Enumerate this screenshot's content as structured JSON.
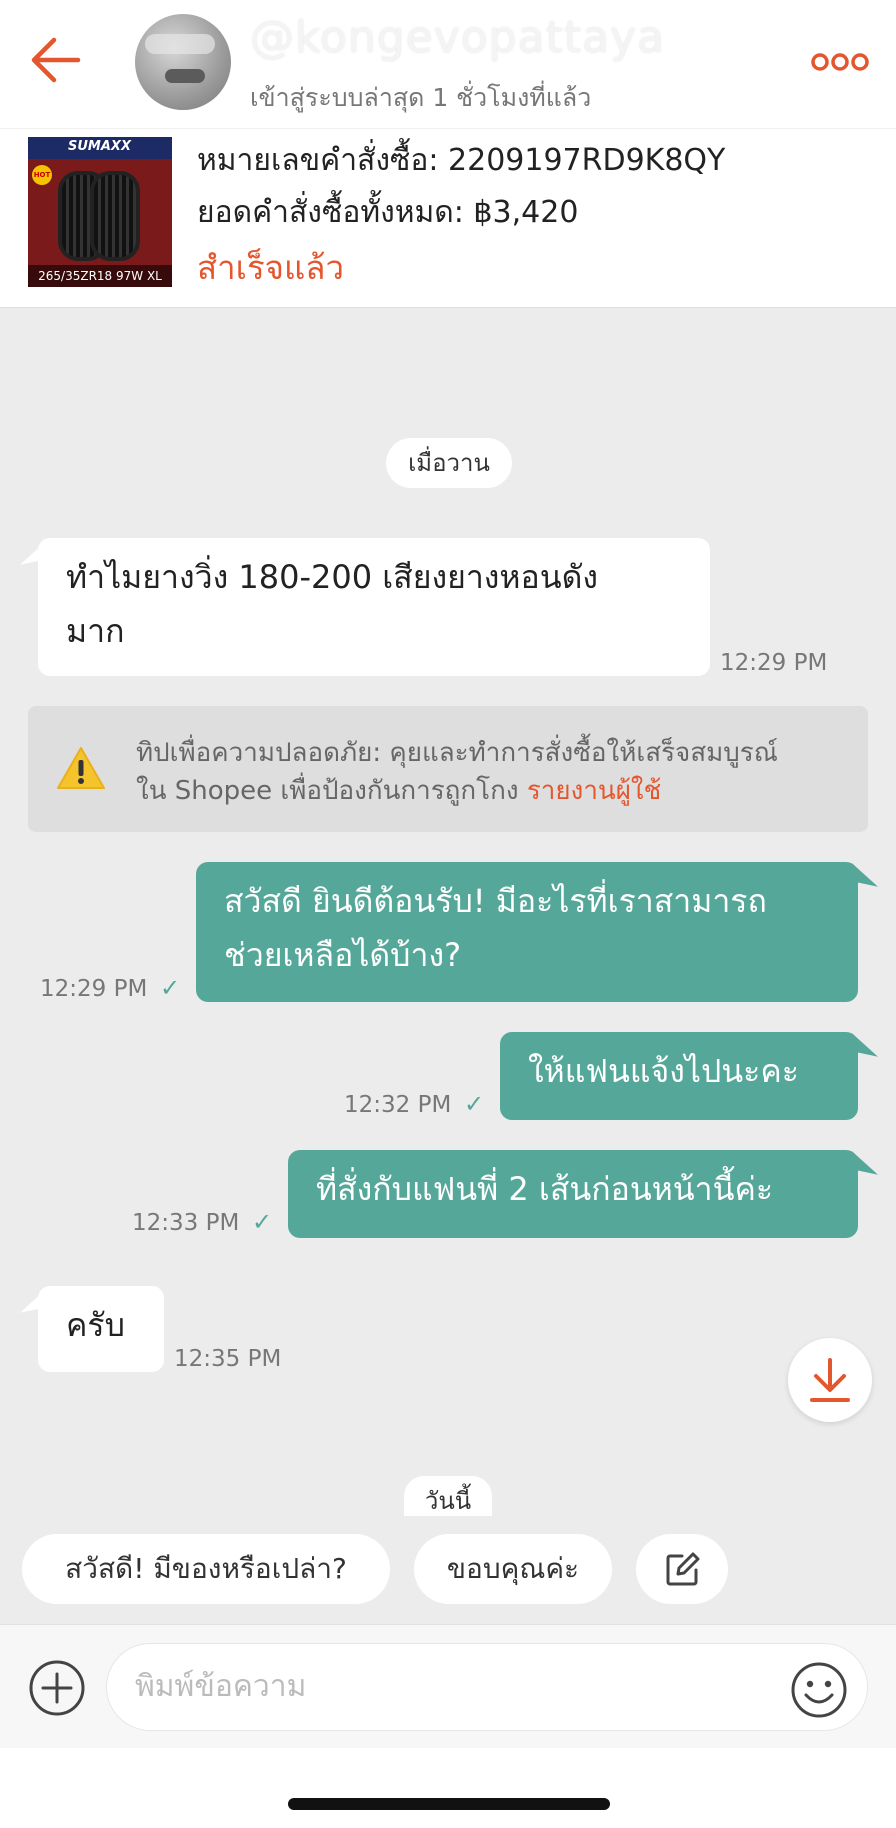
{
  "header": {
    "username": "@kongevopattaya",
    "last_seen": "เข้าสู่ระบบล่าสุด 1 ชั่วโมงที่แล้ว",
    "back_icon": "arrow-left-icon",
    "more_icon": "more-horizontal-icon",
    "accent_color": "#e4572e"
  },
  "order": {
    "thumbnail_brand": "SUMAXX",
    "thumbnail_size_label": "265/35ZR18 97W XL",
    "order_number_line": "หมายเลขคำสั่งซื้อ: 2209197RD9K8QY",
    "order_total_line": "ยอดคำสั่งซื้อทั้งหมด: ฿3,420",
    "status": "สำเร็จแล้ว"
  },
  "chat": {
    "date_yesterday": "เมื่อวาน",
    "date_today": "วันนี้",
    "messages": [
      {
        "direction": "in",
        "lines": [
          "ทำไมยางวิ่ง 180-200  เสียงยางหอนดัง",
          "มาก"
        ],
        "time": "12:29 PM"
      },
      {
        "direction": "out",
        "lines": [
          "สวัสดี ยินดีต้อนรับ! มีอะไรที่เราสามารถ",
          "ช่วยเหลือได้บ้าง?"
        ],
        "time": "12:29 PM"
      },
      {
        "direction": "out",
        "lines": [
          "ให้แฟนแจ้งไปนะคะ"
        ],
        "time": "12:32 PM"
      },
      {
        "direction": "out",
        "lines": [
          "ที่สั่งกับแฟนพี่ 2 เส้นก่อนหน้านี้ค่ะ"
        ],
        "time": "12:33 PM"
      },
      {
        "direction": "in",
        "lines": [
          "ครับ"
        ],
        "time": "12:35 PM"
      }
    ],
    "safety_tip": {
      "line1": "ทิปเพื่อความปลอดภัย: คุยและทำการสั่งซื้อให้เสร็จสมบูรณ์",
      "line2": "ใน Shopee เพื่อป้องกันการถูกโกง",
      "link": "รายงานผู้ใช้",
      "icon": "warning-icon"
    },
    "outgoing_color": "#55a899",
    "download_icon": "download-icon"
  },
  "quick_replies": [
    "สวัสดี! มีของหรือเปล่า?",
    "ขอบคุณค่ะ"
  ],
  "quick_edit_icon": "edit-icon",
  "input": {
    "placeholder": "พิมพ์ข้อความ",
    "plus_icon": "plus-circle-icon",
    "emoji_icon": "emoji-icon"
  }
}
